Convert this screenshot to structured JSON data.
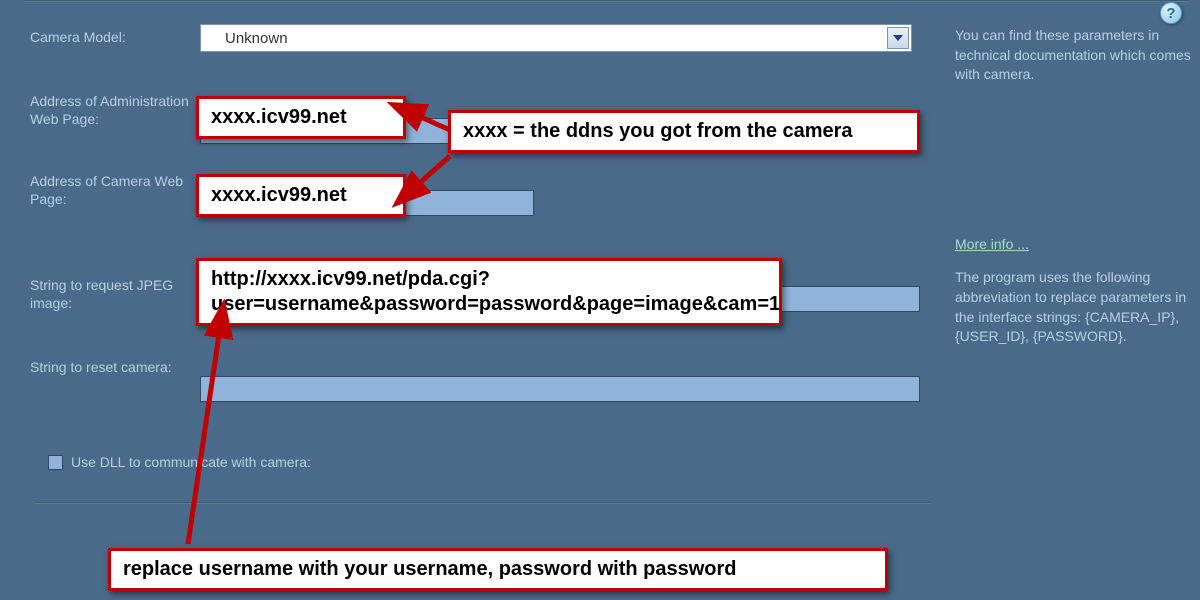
{
  "form": {
    "camera_model_label": "Camera Model:",
    "camera_model_value": "Unknown",
    "admin_addr_label": "Address  of Administration Web Page:",
    "camera_addr_label": "Address  of Camera Web Page:",
    "jpeg_req_label": "String to request JPEG image:",
    "reset_label": "String to reset camera:",
    "use_dll_label": "Use DLL to communicate with camera:"
  },
  "side": {
    "tip_top": "You can find these parameters in technical documentation which comes with camera.",
    "more_info": "More info ...",
    "tip_abbrev": "The program uses the following abbreviation to replace parameters in the interface strings: {CAMERA_IP}, {USER_ID}, {PASSWORD}."
  },
  "callouts": {
    "admin_addr_value": "xxxx.icv99.net",
    "camera_addr_value": "xxxx.icv99.net",
    "ddns_note": "xxxx = the ddns you got from the camera",
    "jpeg_url": "http://xxxx.icv99.net/pda.cgi?user=username&password=password&page=image&cam=1",
    "replace_note": "replace username with your username, password with password"
  },
  "icons": {
    "help": "?"
  }
}
